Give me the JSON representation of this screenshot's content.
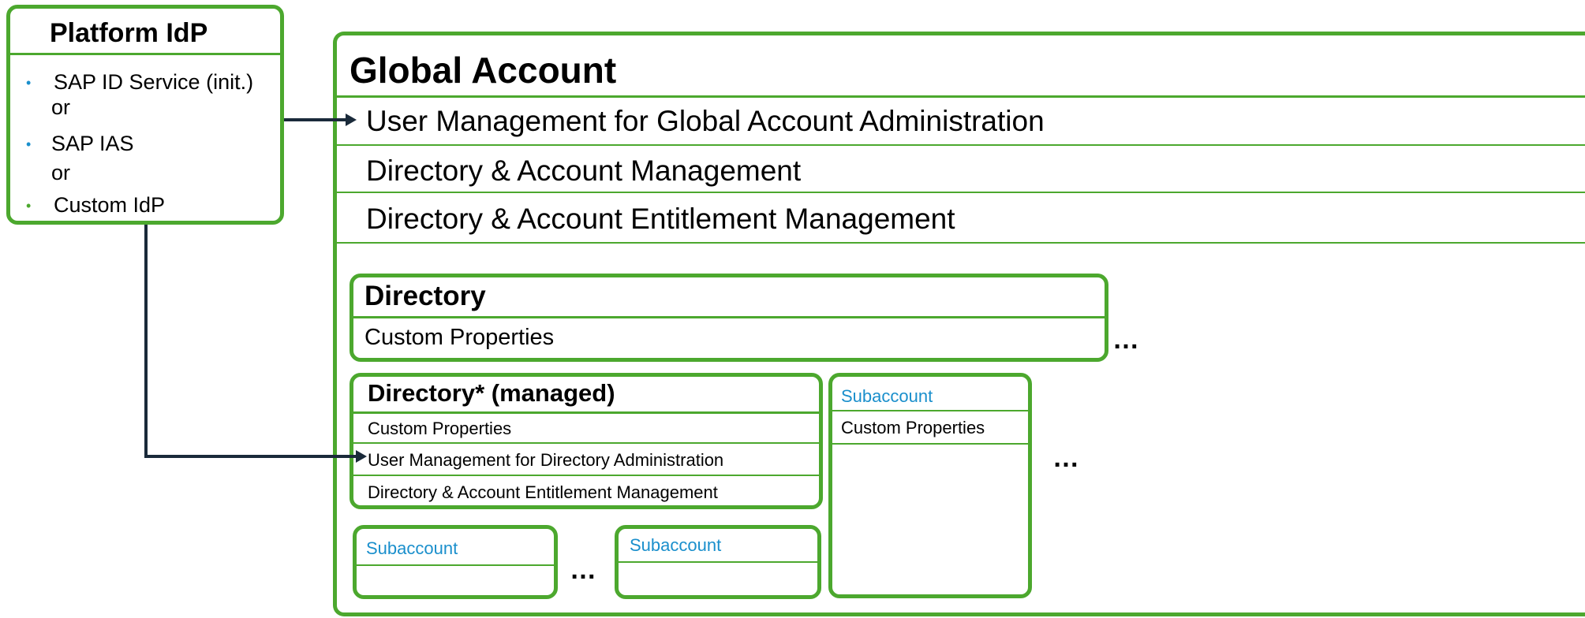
{
  "colors": {
    "box_border": "#4ca82e",
    "subaccount_text": "#1a8fcc",
    "connector": "#1a2a3a",
    "bullet_blue": "#1a8fcc",
    "bullet_green": "#4ca82e"
  },
  "platform_idp": {
    "title": "Platform IdP",
    "items": [
      {
        "text": "SAP ID Service (init.)",
        "bullet": "•"
      },
      {
        "text": "or"
      },
      {
        "text": "SAP IAS",
        "bullet": "•"
      },
      {
        "text": "or"
      },
      {
        "text": "Custom IdP",
        "bullet": "•"
      }
    ]
  },
  "global_account": {
    "title": "Global Account",
    "rows": [
      "User Management for Global Account Administration",
      "Directory & Account Management",
      "Directory & Account Entitlement Management"
    ]
  },
  "directory": {
    "title": "Directory",
    "row": "Custom Properties",
    "ellipsis": "…"
  },
  "managed_directory": {
    "title": "Directory* (managed)",
    "rows": [
      "Custom Properties",
      "User Management for Directory Administration",
      "Directory & Account Entitlement Management"
    ]
  },
  "subaccount_right": {
    "title": "Subaccount",
    "row": "Custom Properties",
    "ellipsis": "…"
  },
  "subaccounts_bottom": [
    {
      "title": "Subaccount"
    },
    {
      "title": "Subaccount"
    }
  ],
  "bottom_ellipsis": "…"
}
